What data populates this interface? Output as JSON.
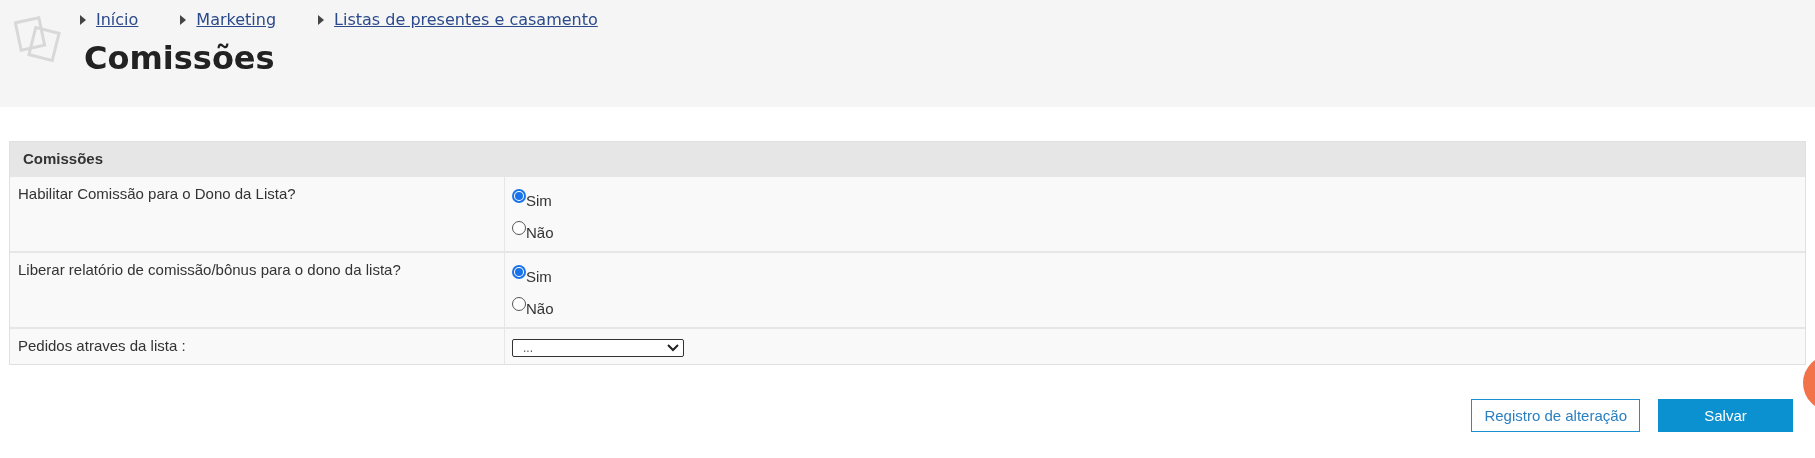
{
  "breadcrumbs": [
    {
      "label": "Início"
    },
    {
      "label": "Marketing"
    },
    {
      "label": "Listas de presentes e casamento"
    }
  ],
  "page_title": "Comissões",
  "section": {
    "title": "Comissões",
    "rows": [
      {
        "kind": "radio",
        "label": "Habilitar Comissão para o Dono da Lista?",
        "options": [
          {
            "label": "Sim",
            "selected": true
          },
          {
            "label": "Não",
            "selected": false
          }
        ]
      },
      {
        "kind": "radio",
        "label": "Liberar relatório de comissão/bônus para o dono da lista?",
        "options": [
          {
            "label": "Sim",
            "selected": true
          },
          {
            "label": "Não",
            "selected": false
          }
        ]
      },
      {
        "kind": "select",
        "label": "Pedidos atraves da lista :",
        "value": "..."
      }
    ]
  },
  "buttons": [
    {
      "label": "Registro de alteração",
      "kind": "secondary"
    },
    {
      "label": "Salvar",
      "kind": "primary"
    }
  ]
}
